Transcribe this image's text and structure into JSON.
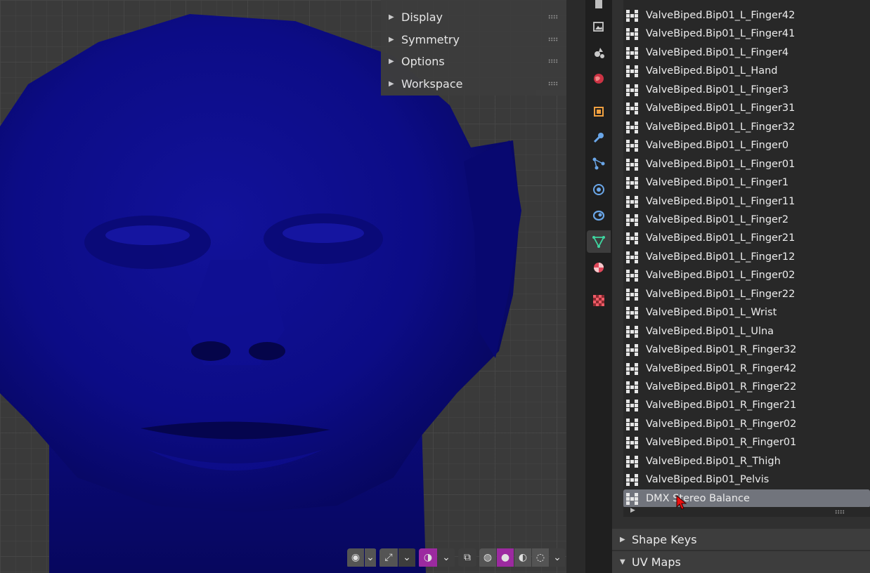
{
  "viewport": {
    "npanel_sections": [
      {
        "label": "Display"
      },
      {
        "label": "Symmetry"
      },
      {
        "label": "Options"
      },
      {
        "label": "Workspace"
      }
    ],
    "header_icons": [
      "visibility-icon",
      "gizmo-icon",
      "overlay-icon",
      "xray-icon",
      "wireframe-shading-icon",
      "solid-shading-icon",
      "material-shading-icon",
      "rendered-shading-icon"
    ],
    "model_color": "#0d0d8c"
  },
  "property_tabs": [
    "tool-icon",
    "render-icon",
    "output-icon",
    "view-layer-icon",
    "scene-icon",
    "world-icon",
    "object-icon",
    "modifier-icon",
    "particles-icon",
    "physics-icon",
    "constraints-icon",
    "data-icon",
    "material-icon",
    "texture-icon"
  ],
  "vertex_groups": [
    {
      "name": "ValveBiped.Bip01_L_Finger42"
    },
    {
      "name": "ValveBiped.Bip01_L_Finger41"
    },
    {
      "name": "ValveBiped.Bip01_L_Finger4"
    },
    {
      "name": "ValveBiped.Bip01_L_Hand"
    },
    {
      "name": "ValveBiped.Bip01_L_Finger3"
    },
    {
      "name": "ValveBiped.Bip01_L_Finger31"
    },
    {
      "name": "ValveBiped.Bip01_L_Finger32"
    },
    {
      "name": "ValveBiped.Bip01_L_Finger0"
    },
    {
      "name": "ValveBiped.Bip01_L_Finger01"
    },
    {
      "name": "ValveBiped.Bip01_L_Finger1"
    },
    {
      "name": "ValveBiped.Bip01_L_Finger11"
    },
    {
      "name": "ValveBiped.Bip01_L_Finger2"
    },
    {
      "name": "ValveBiped.Bip01_L_Finger21"
    },
    {
      "name": "ValveBiped.Bip01_L_Finger12"
    },
    {
      "name": "ValveBiped.Bip01_L_Finger02"
    },
    {
      "name": "ValveBiped.Bip01_L_Finger22"
    },
    {
      "name": "ValveBiped.Bip01_L_Wrist"
    },
    {
      "name": "ValveBiped.Bip01_L_Ulna"
    },
    {
      "name": "ValveBiped.Bip01_R_Finger32"
    },
    {
      "name": "ValveBiped.Bip01_R_Finger42"
    },
    {
      "name": "ValveBiped.Bip01_R_Finger22"
    },
    {
      "name": "ValveBiped.Bip01_R_Finger21"
    },
    {
      "name": "ValveBiped.Bip01_R_Finger02"
    },
    {
      "name": "ValveBiped.Bip01_R_Finger01"
    },
    {
      "name": "ValveBiped.Bip01_R_Thigh"
    },
    {
      "name": "ValveBiped.Bip01_Pelvis"
    },
    {
      "name": "DMX Stereo Balance",
      "selected": true
    }
  ],
  "sections": {
    "shape_keys": "Shape Keys",
    "uv_maps": "UV Maps"
  }
}
